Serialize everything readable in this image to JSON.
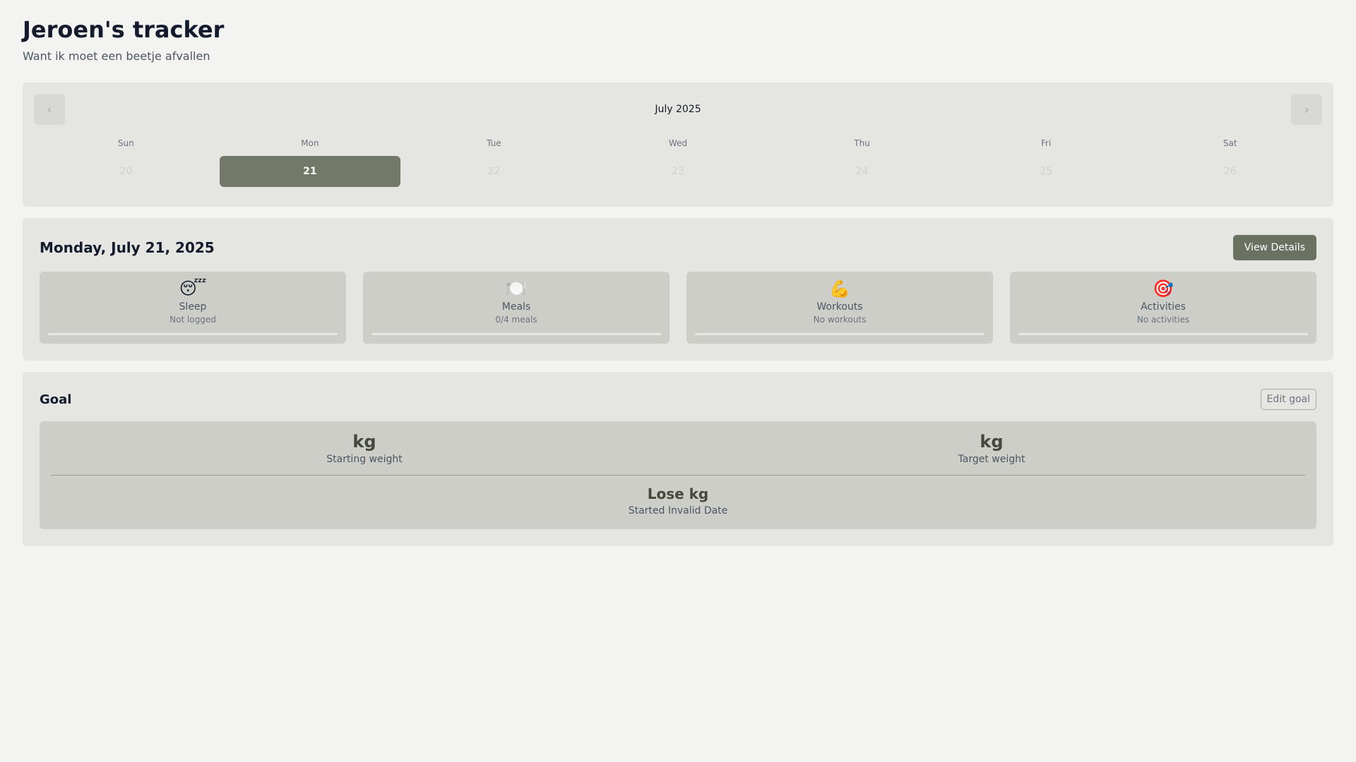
{
  "app": {
    "title": "Jeroen's tracker",
    "subtitle": "Want ik moet een beetje afvallen"
  },
  "calendar": {
    "month_label": "July 2025",
    "prev_icon": "chevron-left-icon",
    "next_icon": "chevron-right-icon",
    "weekdays": [
      "Sun",
      "Mon",
      "Tue",
      "Wed",
      "Thu",
      "Fri",
      "Sat"
    ],
    "days": [
      "20",
      "21",
      "22",
      "23",
      "24",
      "25",
      "26"
    ],
    "selected_day": "21"
  },
  "summary": {
    "date": "Monday, July 21, 2025",
    "view_details_label": "View Details",
    "stats": [
      {
        "icon": "😴",
        "icon_name": "sleep-icon",
        "label": "Sleep",
        "value": "Not logged",
        "progress": 0
      },
      {
        "icon": "🍽️",
        "icon_name": "meals-icon",
        "label": "Meals",
        "value": "0/4 meals",
        "progress": 0
      },
      {
        "icon": "💪",
        "icon_name": "workout-icon",
        "label": "Workouts",
        "value": "No workouts",
        "progress": 0
      },
      {
        "icon": "🎯",
        "icon_name": "target-icon",
        "label": "Activities",
        "value": "No activities",
        "progress": 0
      }
    ]
  },
  "goal": {
    "title": "Goal",
    "edit_label": "Edit goal",
    "starting_weight": "kg",
    "starting_caption": "Starting weight",
    "target_weight": "kg",
    "target_caption": "Target weight",
    "lose_text": "Lose kg",
    "started_text": "Started Invalid Date"
  },
  "colors": {
    "background": "#f3f3f1",
    "card": "#e5e6e1",
    "accent": "#737969",
    "tile": "#cdcec8"
  }
}
